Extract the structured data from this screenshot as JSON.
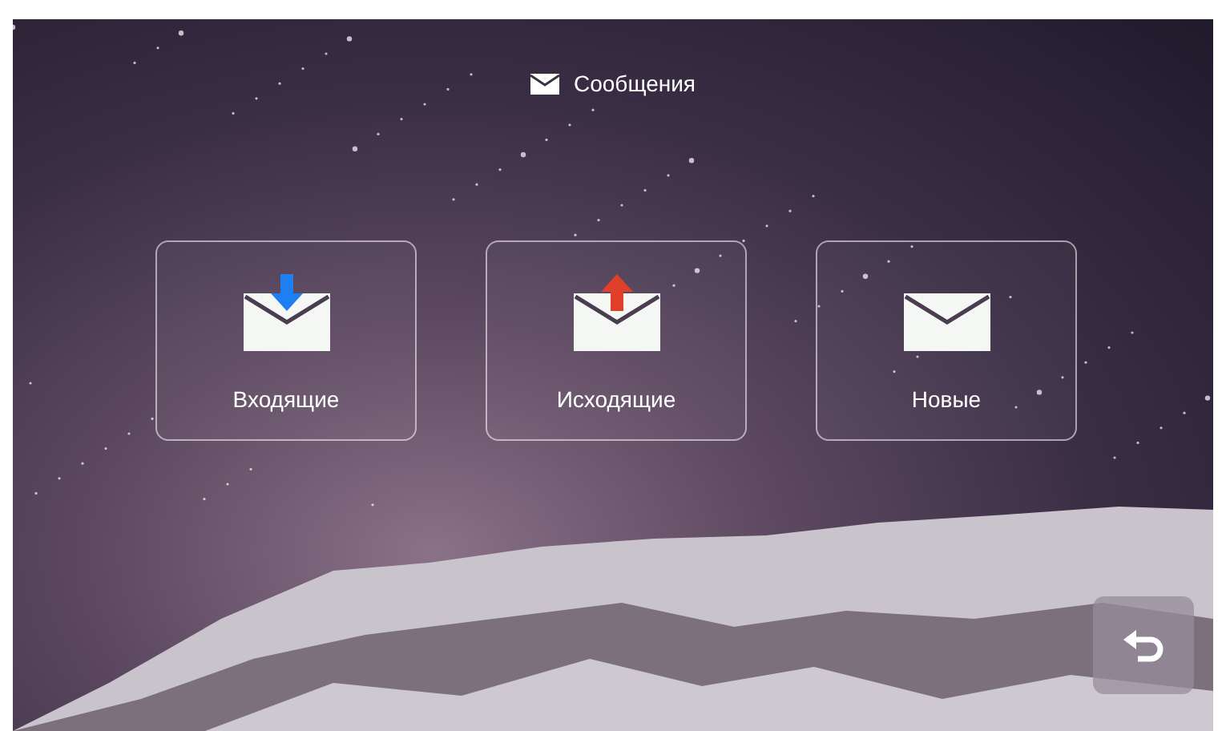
{
  "header": {
    "title": "Сообщения"
  },
  "tiles": [
    {
      "label": "Входящие",
      "kind": "incoming"
    },
    {
      "label": "Исходящие",
      "kind": "outgoing"
    },
    {
      "label": "Новые",
      "kind": "new"
    }
  ]
}
